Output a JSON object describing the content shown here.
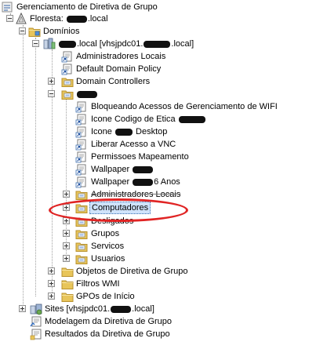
{
  "tree": {
    "root": "Gerenciamento de Diretiva de Grupo",
    "forest_prefix": "Floresta: ",
    "forest_suffix": ".local",
    "domains": "Domínios",
    "domain_suffix": ".local [vhsjpdc01.",
    "domain_suffix2": ".local]",
    "gpo_admin_locais": "Administradores Locais",
    "default_domain_policy": "Default Domain Policy",
    "domain_controllers": "Domain Controllers",
    "gpo_wifi": "Bloqueando Acessos de Gerenciamento de WIFI",
    "gpo_icone_codigo": "Icone Codigo de Etica ",
    "gpo_icone_desktop_a": "Icone ",
    "gpo_icone_desktop_b": " Desktop",
    "gpo_vnc": "Liberar Acesso a VNC",
    "gpo_mapeamento": "Permissoes Mapeamento",
    "gpo_wallpaper": "Wallpaper ",
    "gpo_wallpaper6_a": "Wallpaper ",
    "gpo_wallpaper6_b": "6 Anos",
    "ou_admin_locais": "Administradores Locais",
    "ou_computadores": "Computadores",
    "ou_desligados": "Desligados",
    "ou_grupos": "Grupos",
    "ou_servicos": "Servicos",
    "ou_usuarios": "Usuarios",
    "gpo_objects": "Objetos de Diretiva de Grupo",
    "wmi_filters": "Filtros WMI",
    "starter_gpos": "GPOs de Início",
    "sites_prefix": "Sites [vhsjpdc01.",
    "sites_suffix": ".local]",
    "modeling": "Modelagem da Diretiva de Grupo",
    "results": "Resultados da Diretiva de Grupo"
  },
  "icons": {
    "root": "gpmc-icon",
    "forest": "forest-icon",
    "domains": "folder-icon",
    "domain": "domain-icon",
    "gpo_link": "gpo-link-icon",
    "ou": "ou-folder-icon",
    "folder": "folder-icon",
    "sites": "sites-icon",
    "modeling": "modeling-icon",
    "results": "results-icon"
  },
  "colors": {
    "folder": "#e8c55a",
    "folder_edge": "#b8912f",
    "highlight_ellipse": "#e02424",
    "selection": "#cfe3fb"
  }
}
